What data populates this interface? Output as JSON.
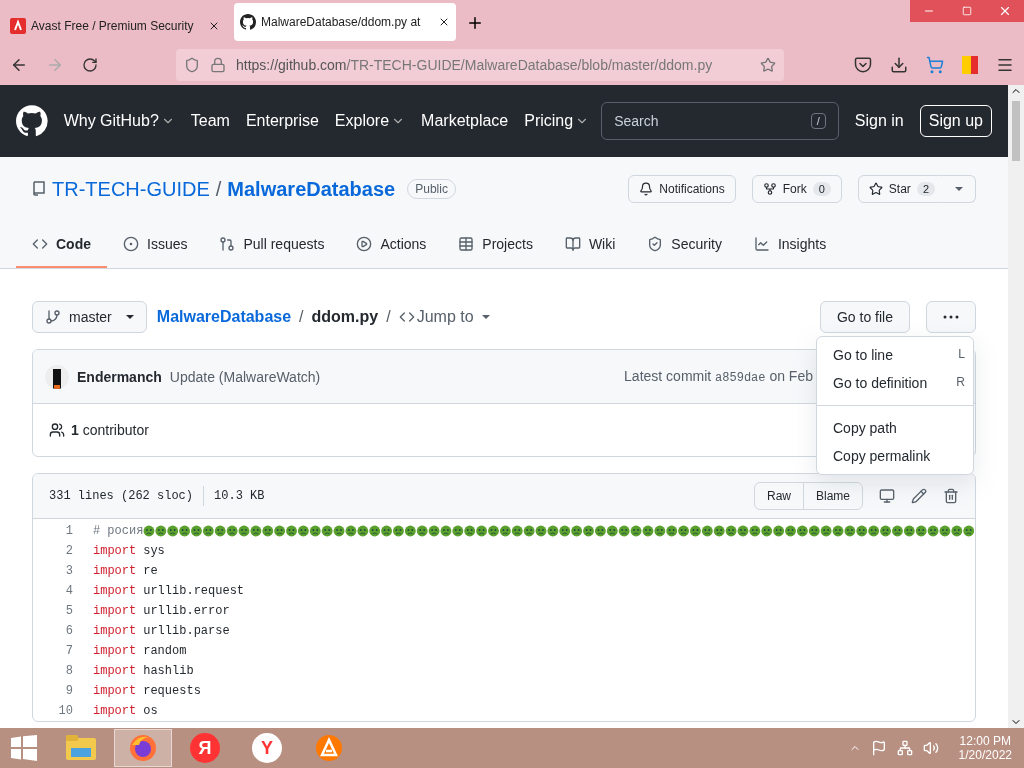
{
  "browser": {
    "tabs": [
      {
        "title": "Avast Free / Premium Security",
        "selected": false,
        "kind": "avast"
      },
      {
        "title": "MalwareDatabase/ddom.py at",
        "selected": true,
        "kind": "github"
      }
    ],
    "url_host": "https://github.com",
    "url_path": "/TR-TECH-GUIDE/MalwareDatabase/blob/master/ddom.py"
  },
  "header": {
    "nav": [
      {
        "label": "Why GitHub?",
        "caret": true
      },
      {
        "label": "Team",
        "caret": false
      },
      {
        "label": "Enterprise",
        "caret": false
      },
      {
        "label": "Explore",
        "caret": true
      },
      {
        "label": "Marketplace",
        "caret": false
      },
      {
        "label": "Pricing",
        "caret": true
      }
    ],
    "search": {
      "placeholder": "Search",
      "key": "/"
    },
    "sign_in": "Sign in",
    "sign_up": "Sign up"
  },
  "repo": {
    "owner": "TR-TECH-GUIDE",
    "separator": "/",
    "name": "MalwareDatabase",
    "visibility": "Public",
    "actions": [
      {
        "label": "Notifications",
        "kind": "bell"
      },
      {
        "label": "Fork",
        "count": "0",
        "kind": "fork"
      },
      {
        "label": "Star",
        "count": "2",
        "kind": "star"
      }
    ],
    "tabs": [
      {
        "label": "Code",
        "kind": "code",
        "selected": true
      },
      {
        "label": "Issues",
        "kind": "issues",
        "selected": false
      },
      {
        "label": "Pull requests",
        "kind": "pr",
        "selected": false
      },
      {
        "label": "Actions",
        "kind": "play",
        "selected": false
      },
      {
        "label": "Projects",
        "kind": "table",
        "selected": false
      },
      {
        "label": "Wiki",
        "kind": "book",
        "selected": false
      },
      {
        "label": "Security",
        "kind": "shield",
        "selected": false
      },
      {
        "label": "Insights",
        "kind": "graph",
        "selected": false
      }
    ]
  },
  "file": {
    "branch": "master",
    "separator_1": "/",
    "separator_2": "/",
    "repo_link": "MalwareDatabase",
    "filename": "ddom.py",
    "jump": "Jump to",
    "go_to_file": "Go to file",
    "commit": {
      "author": "Endermanch",
      "message": "Update (MalwareWatch)",
      "latest": "Latest commit",
      "sha": "a859dae",
      "date": "on Feb"
    },
    "contributors_count": "1",
    "contributors_label": "contributor",
    "stats": "331 lines (262 sloc)",
    "size": "10.3 KB",
    "raw": "Raw",
    "blame": "Blame",
    "lines": [
      {
        "n": "1",
        "text": "# росия",
        "kind": "comment"
      },
      {
        "n": "2",
        "kw": "import",
        "text": "sys",
        "kind": "code"
      },
      {
        "n": "3",
        "kw": "import",
        "text": "re",
        "kind": "code"
      },
      {
        "n": "4",
        "kw": "import",
        "text": "urllib.request",
        "kind": "code"
      },
      {
        "n": "5",
        "kw": "import",
        "text": "urllib.error",
        "kind": "code"
      },
      {
        "n": "6",
        "kw": "import",
        "text": "urllib.parse",
        "kind": "code"
      },
      {
        "n": "7",
        "kw": "import",
        "text": "random",
        "kind": "code"
      },
      {
        "n": "8",
        "kw": "import",
        "text": "hashlib",
        "kind": "code"
      },
      {
        "n": "9",
        "kw": "import",
        "text": "requests",
        "kind": "code"
      },
      {
        "n": "10",
        "kw": "import",
        "text": "os",
        "kind": "code"
      }
    ]
  },
  "menu": [
    {
      "label": "Go to line",
      "key": "L",
      "divider_above": false
    },
    {
      "label": "Go to definition",
      "key": "R",
      "divider_above": false
    },
    {
      "label": "Copy path",
      "divider_above": true
    },
    {
      "label": "Copy permalink",
      "divider_above": false
    }
  ],
  "taskbar": {
    "apps": [
      {
        "kind": "explorer",
        "active": false
      },
      {
        "kind": "firefox",
        "active": true
      },
      {
        "kind": "yandex",
        "glyph": "Я",
        "active": false
      },
      {
        "kind": "ybrowser",
        "glyph": "Y",
        "active": false
      },
      {
        "kind": "avast",
        "active": false
      }
    ],
    "time": "12:00 PM",
    "date": "1/20/2022"
  }
}
